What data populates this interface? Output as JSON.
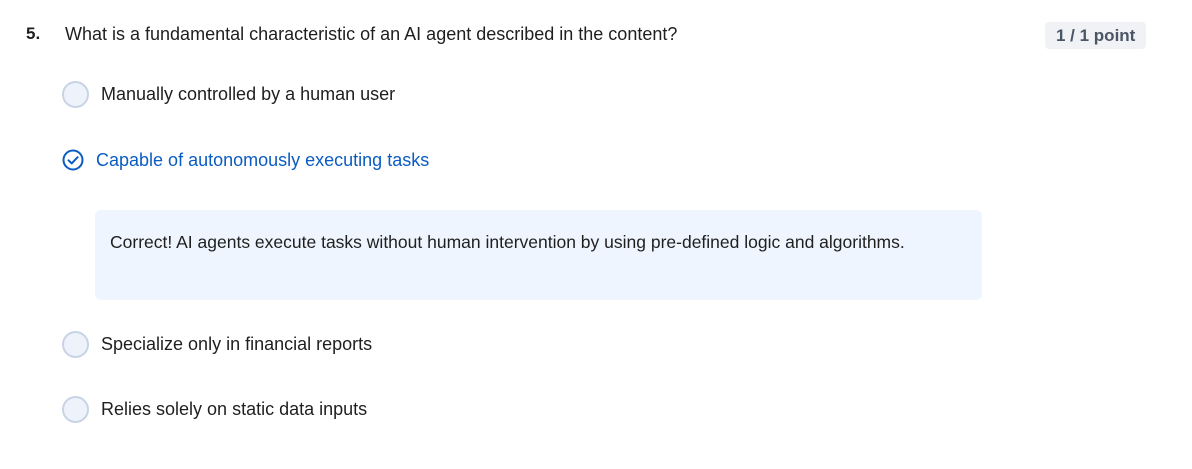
{
  "question": {
    "number": "5.",
    "text": "What is a fundamental characteristic of an AI agent described in the content?",
    "points": "1 / 1 point"
  },
  "options": [
    {
      "label": "Manually controlled by a human user",
      "selected": false
    },
    {
      "label": "Capable of autonomously executing tasks",
      "selected": true
    },
    {
      "label": "Specialize only in financial reports",
      "selected": false
    },
    {
      "label": "Relies solely on static data inputs",
      "selected": false
    }
  ],
  "feedback": {
    "text": "Correct! AI agents execute tasks without human intervention by using pre-defined logic and algorithms."
  },
  "colors": {
    "accent": "#0b5cc1",
    "feedback_bg": "#eef5ff",
    "badge_bg": "#f0f2f5"
  }
}
